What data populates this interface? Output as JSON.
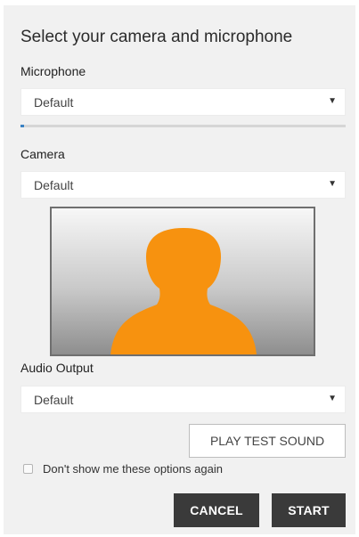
{
  "dialog": {
    "title": "Select your camera and microphone"
  },
  "microphone": {
    "label": "Microphone",
    "selected": "Default",
    "level_fraction": 0.01
  },
  "camera": {
    "label": "Camera",
    "selected": "Default"
  },
  "audio_output": {
    "label": "Audio Output",
    "selected": "Default"
  },
  "buttons": {
    "play_test_sound": "PLAY TEST SOUND",
    "cancel": "CANCEL",
    "start": "START"
  },
  "dont_show": {
    "label": "Don't show me these options again",
    "checked": false
  },
  "icons": {
    "dropdown": "dropdown-arrow-icon",
    "placeholder": "person-silhouette-icon"
  },
  "colors": {
    "silhouette": "#f7920f",
    "dark_button": "#3a3a3a",
    "panel": "#f1f1f1"
  }
}
